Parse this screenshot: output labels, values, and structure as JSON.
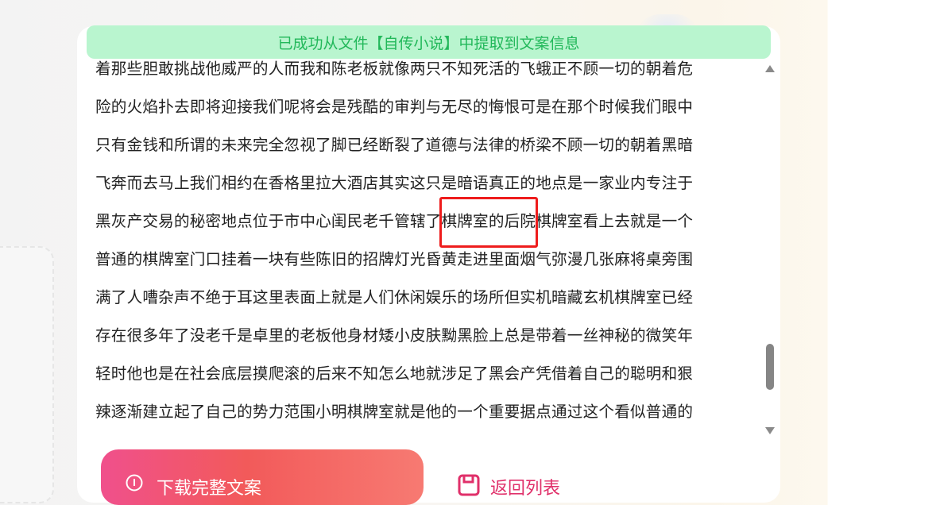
{
  "toast": {
    "message": "已成功从文件【自传小说】中提取到文案信息"
  },
  "content": {
    "lines": [
      "着那些胆敢挑战他威严的人而我和陈老板就像两只不知死活的飞蛾正不顾一切的朝着危",
      "险的火焰扑去即将迎接我们呢将会是残酷的审判与无尽的悔恨可是在那个时候我们眼中",
      "只有金钱和所谓的未来完全忽视了脚已经断裂了道德与法律的桥梁不顾一切的朝着黑暗",
      "飞奔而去马上我们相约在香格里拉大酒店其实这只是暗语真正的地点是一家业内专注于",
      "黑灰产交易的秘密地点位于市中心闺民老千管辖了棋牌室的后院棋牌室看上去就是一个",
      "普通的棋牌室门口挂着一块有些陈旧的招牌灯光昏黄走进里面烟气弥漫几张麻将桌旁围",
      "满了人嘈杂声不绝于耳这里表面上就是人们休闲娱乐的场所但实机暗藏玄机棋牌室已经",
      "存在很多年了没老千是卓里的老板他身材矮小皮肤黝黑脸上总是带着一丝神秘的微笑年",
      "轻时他也是在社会底层摸爬滚的后来不知怎么地就涉足了黑会产凭借着自己的聪明和狠",
      "辣逐渐建立起了自己的势力范围小明棋牌室就是他的一个重要据点通过这个看似普通的"
    ]
  },
  "actions": {
    "download_label": "下载完整文案",
    "back_label": "返回列表"
  },
  "colors": {
    "toast_bg": "#b9f5cf",
    "toast_text": "#22b85a",
    "highlight": "#ee1c1c",
    "accent_pink": "#e0306a"
  },
  "icons": {
    "download": "download-icon",
    "back": "save-icon",
    "scroll_up": "scroll-up-arrow-icon",
    "scroll_down": "scroll-down-arrow-icon"
  }
}
